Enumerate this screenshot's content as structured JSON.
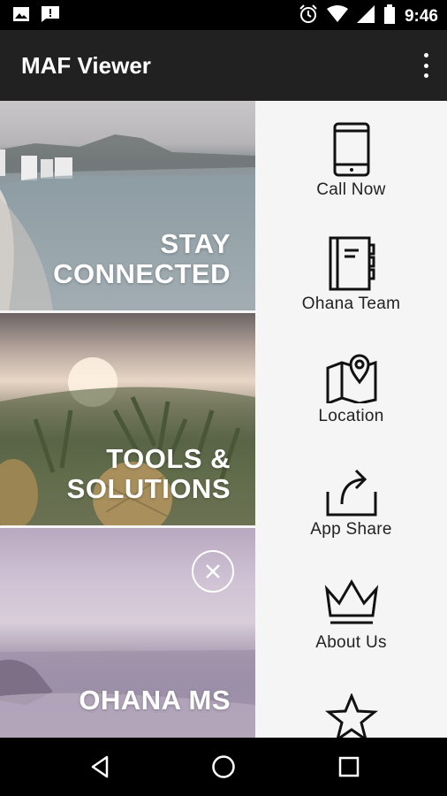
{
  "status_bar": {
    "time": "9:46",
    "left_icons": [
      "image-icon",
      "message-alert-icon"
    ],
    "right_icons": [
      "alarm-icon",
      "wifi-icon",
      "signal-icon",
      "battery-icon"
    ]
  },
  "app_bar": {
    "title": "MAF Viewer",
    "overflow_icon": "more-vert-icon"
  },
  "tiles": [
    {
      "label_line1": "STAY",
      "label_line2": "CONNECTED"
    },
    {
      "label_line1": "TOOLS &",
      "label_line2": "SOLUTIONS"
    },
    {
      "label_line1": "",
      "label_line2": "OHANA MS",
      "close_icon": "close-circle-icon"
    }
  ],
  "menu": {
    "items": [
      {
        "label": "Call Now",
        "icon": "phone-icon"
      },
      {
        "label": "Ohana Team",
        "icon": "notebook-icon"
      },
      {
        "label": "Location",
        "icon": "map-pin-icon"
      },
      {
        "label": "App Share",
        "icon": "share-icon"
      },
      {
        "label": "About Us",
        "icon": "crown-icon"
      },
      {
        "label": "",
        "icon": "star-icon"
      }
    ]
  },
  "nav_bar": {
    "icons": [
      "back-icon",
      "home-icon",
      "recents-icon"
    ]
  },
  "colors": {
    "app_bar": "#212121",
    "menu_background": "#f5f5f5",
    "menu_text": "#222222"
  }
}
